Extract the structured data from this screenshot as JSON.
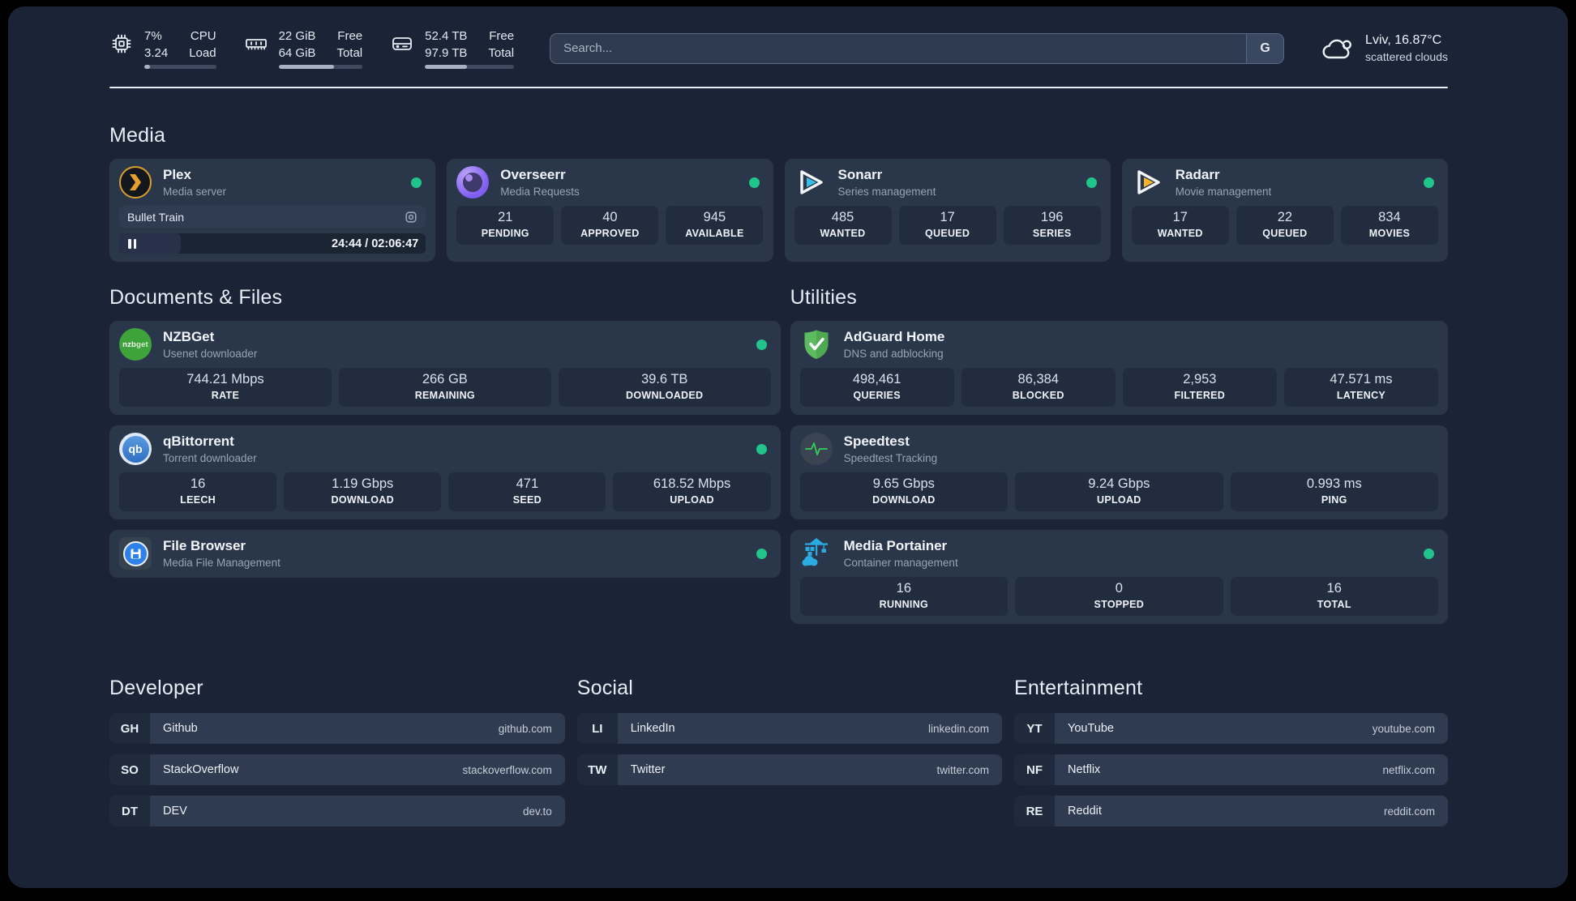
{
  "header": {
    "system_stats": [
      {
        "icon": "cpu-icon",
        "col1_top": "7%",
        "col2_top": "CPU",
        "col1_bottom": "3.24",
        "col2_bottom": "Load",
        "progress_pct": 8
      },
      {
        "icon": "memory-icon",
        "col1_top": "22 GiB",
        "col2_top": "Free",
        "col1_bottom": "64 GiB",
        "col2_bottom": "Total",
        "progress_pct": 66
      },
      {
        "icon": "disk-icon",
        "col1_top": "52.4 TB",
        "col2_top": "Free",
        "col1_bottom": "97.9 TB",
        "col2_bottom": "Total",
        "progress_pct": 47
      }
    ],
    "search": {
      "placeholder": "Search...",
      "engine_label": "G"
    },
    "weather": {
      "icon": "cloud-icon",
      "location_temp": "Lviv, 16.87°C",
      "condition": "scattered clouds"
    }
  },
  "media": {
    "title": "Media",
    "plex": {
      "icon": "plex-icon",
      "name": "Plex",
      "description": "Media server",
      "online": true,
      "now_playing": {
        "title": "Bullet Train",
        "time_display": "24:44 / 02:06:47",
        "progress_pct": 20
      }
    },
    "cards": [
      {
        "icon": "overseerr-icon",
        "name": "Overseerr",
        "description": "Media Requests",
        "online": true,
        "stats": [
          {
            "value": "21",
            "label": "PENDING"
          },
          {
            "value": "40",
            "label": "APPROVED"
          },
          {
            "value": "945",
            "label": "AVAILABLE"
          }
        ]
      },
      {
        "icon": "sonarr-icon",
        "name": "Sonarr",
        "description": "Series management",
        "online": true,
        "stats": [
          {
            "value": "485",
            "label": "WANTED"
          },
          {
            "value": "17",
            "label": "QUEUED"
          },
          {
            "value": "196",
            "label": "SERIES"
          }
        ]
      },
      {
        "icon": "radarr-icon",
        "name": "Radarr",
        "description": "Movie management",
        "online": true,
        "stats": [
          {
            "value": "17",
            "label": "WANTED"
          },
          {
            "value": "22",
            "label": "QUEUED"
          },
          {
            "value": "834",
            "label": "MOVIES"
          }
        ]
      }
    ]
  },
  "documents": {
    "title": "Documents & Files",
    "cards": [
      {
        "icon": "nzbget-icon",
        "name": "NZBGet",
        "description": "Usenet downloader",
        "online": true,
        "stats": [
          {
            "value": "744.21 Mbps",
            "label": "RATE"
          },
          {
            "value": "266 GB",
            "label": "REMAINING"
          },
          {
            "value": "39.6 TB",
            "label": "DOWNLOADED"
          }
        ]
      },
      {
        "icon": "qbittorrent-icon",
        "name": "qBittorrent",
        "description": "Torrent downloader",
        "online": true,
        "stats": [
          {
            "value": "16",
            "label": "LEECH"
          },
          {
            "value": "1.19 Gbps",
            "label": "DOWNLOAD"
          },
          {
            "value": "471",
            "label": "SEED"
          },
          {
            "value": "618.52 Mbps",
            "label": "UPLOAD"
          }
        ]
      },
      {
        "icon": "filebrowser-icon",
        "name": "File Browser",
        "description": "Media File Management",
        "online": true,
        "stats": []
      }
    ]
  },
  "utilities": {
    "title": "Utilities",
    "cards": [
      {
        "icon": "adguard-icon",
        "name": "AdGuard Home",
        "description": "DNS and adblocking",
        "online": false,
        "stats": [
          {
            "value": "498,461",
            "label": "QUERIES"
          },
          {
            "value": "86,384",
            "label": "BLOCKED"
          },
          {
            "value": "2,953",
            "label": "FILTERED"
          },
          {
            "value": "47.571 ms",
            "label": "LATENCY"
          }
        ]
      },
      {
        "icon": "speedtest-icon",
        "name": "Speedtest",
        "description": "Speedtest Tracking",
        "online": false,
        "stats": [
          {
            "value": "9.65 Gbps",
            "label": "DOWNLOAD"
          },
          {
            "value": "9.24 Gbps",
            "label": "UPLOAD"
          },
          {
            "value": "0.993 ms",
            "label": "PING"
          }
        ]
      },
      {
        "icon": "portainer-icon",
        "name": "Media Portainer",
        "description": "Container management",
        "online": true,
        "stats": [
          {
            "value": "16",
            "label": "RUNNING"
          },
          {
            "value": "0",
            "label": "STOPPED"
          },
          {
            "value": "16",
            "label": "TOTAL"
          }
        ]
      }
    ]
  },
  "bookmarks": [
    {
      "title": "Developer",
      "links": [
        {
          "abbr": "GH",
          "label": "Github",
          "url": "github.com"
        },
        {
          "abbr": "SO",
          "label": "StackOverflow",
          "url": "stackoverflow.com"
        },
        {
          "abbr": "DT",
          "label": "DEV",
          "url": "dev.to"
        }
      ]
    },
    {
      "title": "Social",
      "links": [
        {
          "abbr": "LI",
          "label": "LinkedIn",
          "url": "linkedin.com"
        },
        {
          "abbr": "TW",
          "label": "Twitter",
          "url": "twitter.com"
        }
      ]
    },
    {
      "title": "Entertainment",
      "links": [
        {
          "abbr": "YT",
          "label": "YouTube",
          "url": "youtube.com"
        },
        {
          "abbr": "NF",
          "label": "Netflix",
          "url": "netflix.com"
        },
        {
          "abbr": "RE",
          "label": "Reddit",
          "url": "reddit.com"
        }
      ]
    }
  ],
  "colors": {
    "status_online": "#21c48b",
    "plex_accent": "#e6a02c",
    "overseerr_accent": "#8b6cf0",
    "sonarr_accent": "#38bde8",
    "radarr_accent": "#f7b52c",
    "nzbget_accent": "#3fa33c",
    "qbittorrent_accent": "#3f7fd4",
    "filebrowser_accent": "#2f80e8",
    "adguard_accent": "#5cbb60",
    "speedtest_accent": "#31d158",
    "portainer_accent": "#2aace3"
  }
}
